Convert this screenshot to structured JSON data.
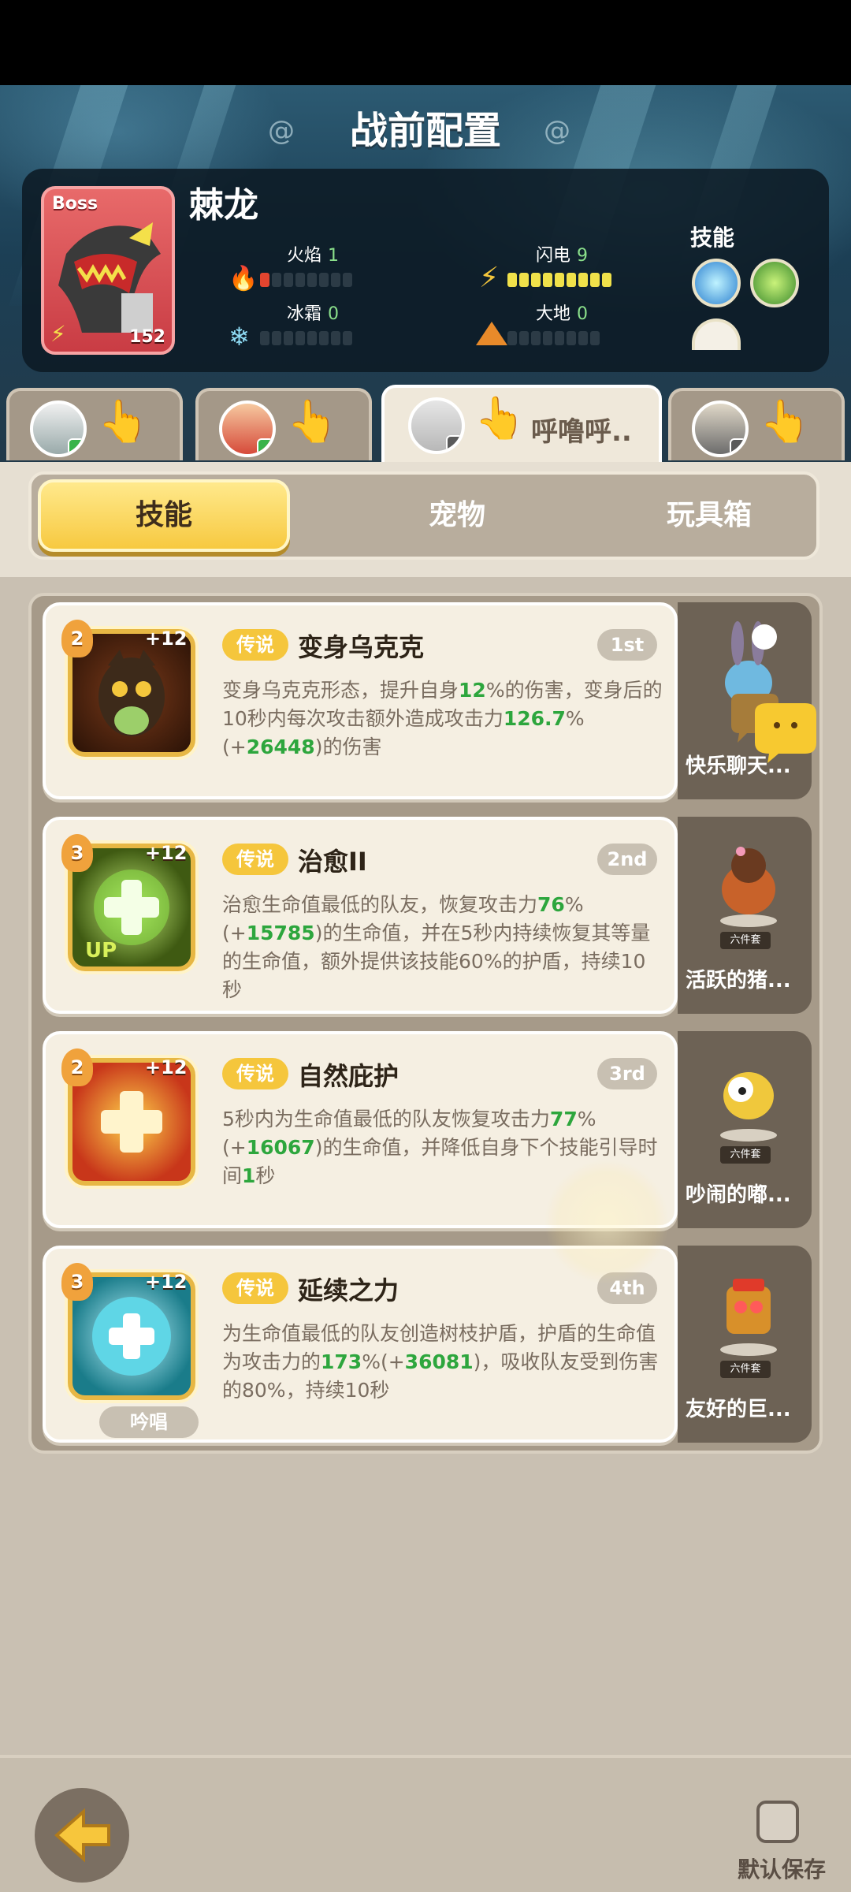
{
  "header": {
    "title": "战前配置",
    "boss": {
      "badge": "Boss",
      "level": "152",
      "name": "棘龙",
      "elements": [
        {
          "label": "火焰",
          "value": "1"
        },
        {
          "label": "闪电",
          "value": "9"
        },
        {
          "label": "冰霜",
          "value": "0"
        },
        {
          "label": "大地",
          "value": "0"
        }
      ],
      "skills_label": "技能"
    }
  },
  "team_tabs": [
    {
      "name": ""
    },
    {
      "name": ""
    },
    {
      "name": "呼噜呼.."
    },
    {
      "name": ""
    }
  ],
  "segments": {
    "skills": "技能",
    "pets": "宠物",
    "toybox": "玩具箱"
  },
  "skills": [
    {
      "level": "2",
      "plus": "+12",
      "rarity": "传说",
      "name": "变身乌克克",
      "rank": "1st",
      "desc": [
        {
          "t": "变身乌克克形态，提升自身"
        },
        {
          "t": "12",
          "g": true
        },
        {
          "t": "%的伤害，变身后的10秒内每次攻击额外造成攻击力"
        },
        {
          "t": "126.7",
          "g": true
        },
        {
          "t": "%(+"
        },
        {
          "t": "26448",
          "g": true
        },
        {
          "t": ")的伤害"
        }
      ],
      "pet": {
        "name": "快乐聊天...",
        "set": ""
      }
    },
    {
      "level": "3",
      "plus": "+12",
      "rarity": "传说",
      "name": "治愈II",
      "rank": "2nd",
      "desc": [
        {
          "t": "治愈生命值最低的队友，恢复攻击力"
        },
        {
          "t": "76",
          "g": true
        },
        {
          "t": "%(+"
        },
        {
          "t": "15785",
          "g": true
        },
        {
          "t": ")的生命值，并在5秒内持续恢复其等量的生命值，额外提供该技能60%的护盾，持续10秒"
        }
      ],
      "pet": {
        "name": "活跃的猪...",
        "set": "六件套"
      }
    },
    {
      "level": "2",
      "plus": "+12",
      "rarity": "传说",
      "name": "自然庇护",
      "rank": "3rd",
      "desc": [
        {
          "t": "5秒内为生命值最低的队友恢复攻击力"
        },
        {
          "t": "77",
          "g": true
        },
        {
          "t": "%(+"
        },
        {
          "t": "16067",
          "g": true
        },
        {
          "t": ")的生命值，并降低自身下个技能引导时间"
        },
        {
          "t": "1",
          "g": true
        },
        {
          "t": "秒"
        }
      ],
      "pet": {
        "name": "吵闹的嘟...",
        "set": "六件套"
      }
    },
    {
      "level": "3",
      "plus": "+12",
      "rarity": "传说",
      "name": "延续之力",
      "rank": "4th",
      "desc": [
        {
          "t": "为生命值最低的队友创造树枝护盾，护盾的生命值为攻击力的"
        },
        {
          "t": "173",
          "g": true
        },
        {
          "t": "%(+"
        },
        {
          "t": "36081",
          "g": true
        },
        {
          "t": ")，吸收队友受到伤害的80%，持续10秒"
        }
      ],
      "chant": "吟唱",
      "pet": {
        "name": "友好的巨...",
        "set": "六件套"
      }
    }
  ],
  "footer": {
    "default_save": "默认保存"
  },
  "colors": {
    "legend_gold": "#f5c63c",
    "highlight_green": "#2da63d",
    "panel_bg": "#a69a89"
  }
}
